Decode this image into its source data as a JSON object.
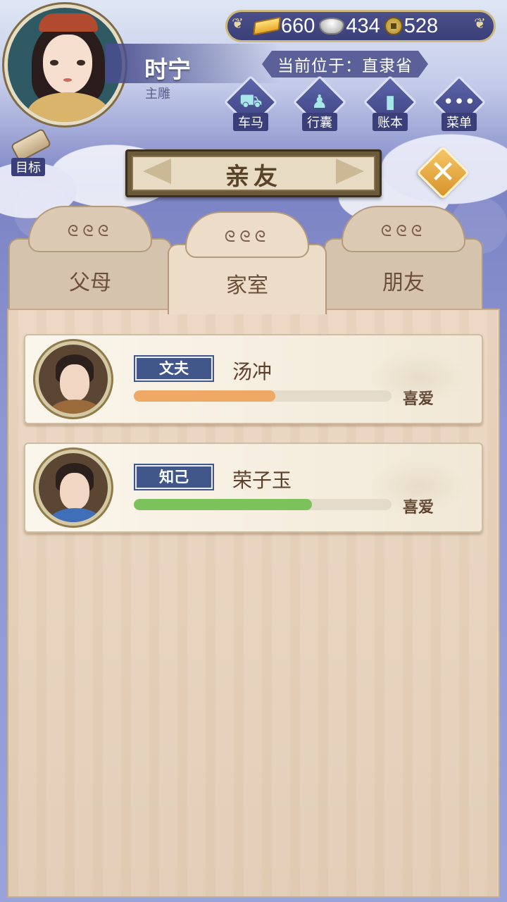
{
  "player": {
    "name": "时宁",
    "title": "主雕"
  },
  "currency": [
    {
      "icon": "gold-ingot-icon",
      "value": "660"
    },
    {
      "icon": "silver-ingot-icon",
      "value": "434"
    },
    {
      "icon": "copper-coin-icon",
      "value": "528"
    }
  ],
  "location": "当前位于：直隶省",
  "nav": [
    {
      "label": "车马",
      "icon": "carriage-icon"
    },
    {
      "label": "行囊",
      "icon": "bundle-icon"
    },
    {
      "label": "账本",
      "icon": "ledger-icon"
    },
    {
      "label": "菜单",
      "icon": "more-icon"
    }
  ],
  "goal_label": "目标",
  "page_title": "亲友",
  "tabs": [
    {
      "label": "父母",
      "active": false
    },
    {
      "label": "家室",
      "active": true
    },
    {
      "label": "朋友",
      "active": false
    }
  ],
  "relations": [
    {
      "role": "文夫",
      "name": "汤冲",
      "affection": "喜爱",
      "progress": 0.55,
      "bar_color": "#f0a965"
    },
    {
      "role": "知己",
      "name": "荣子玉",
      "affection": "喜爱",
      "progress": 0.69,
      "bar_color": "#7cc25c"
    }
  ],
  "colors": {
    "accent": "#415789",
    "panel": "#e6d3bd",
    "header": "#3c4079"
  }
}
